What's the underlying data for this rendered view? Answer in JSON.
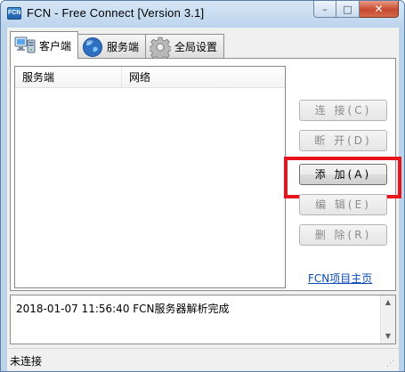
{
  "window": {
    "title": "FCN - Free Connect [Version 3.1]",
    "icon_label": "FCN",
    "min_glyph": "–",
    "max_glyph": "□",
    "close_glyph": "✕"
  },
  "tabs": [
    {
      "label": "客户端",
      "icon": "computer-icon",
      "active": true
    },
    {
      "label": "服务端",
      "icon": "globe-icon",
      "active": false
    },
    {
      "label": "全局设置",
      "icon": "gear-icon",
      "active": false
    }
  ],
  "list": {
    "columns": [
      "服务端",
      "网络"
    ],
    "rows": []
  },
  "buttons": {
    "connect": "连 接(C)",
    "disconnect": "断 开(D)",
    "add": "添 加(A)",
    "edit": "编 辑(E)",
    "delete": "删 除(R)"
  },
  "project_link": "FCN项目主页",
  "log": {
    "lines": [
      "2018-01-07 11:56:40 FCN服务器解析完成"
    ]
  },
  "status": {
    "text": "未连接"
  },
  "colors": {
    "highlight": "#e8141c",
    "link": "#0b4bb8"
  }
}
